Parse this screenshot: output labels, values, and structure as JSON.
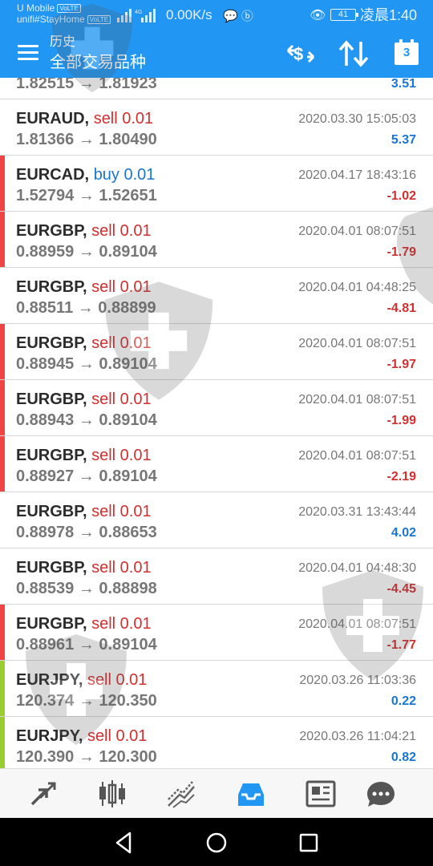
{
  "status_bar": {
    "carrier_line1": "U Mobile",
    "carrier_line2": "unifi#StayHome",
    "volte_tag": "VoLTE",
    "net_speed": "0.00K/s",
    "battery": "41",
    "time": "凌晨1:40"
  },
  "header": {
    "title": "历史",
    "subtitle": "全部交易品种",
    "calendar_badge": "3",
    "colors": {
      "primary": "#2196f3"
    }
  },
  "trades": [
    {
      "symbol": "",
      "action": "",
      "prices": "1.82515 → 1.81923",
      "time": "",
      "profit": "3.51",
      "sign": "pos",
      "bar": ""
    },
    {
      "symbol": "EURAUD,",
      "action": "sell 0.01",
      "prices": "1.81366 → 1.80490",
      "time": "2020.03.30 15:05:03",
      "profit": "5.37",
      "sign": "pos",
      "bar": ""
    },
    {
      "symbol": "EURCAD,",
      "action": "buy 0.01",
      "prices": "1.52794 → 1.52651",
      "time": "2020.04.17 18:43:16",
      "profit": "-1.02",
      "sign": "neg",
      "bar": "#ef4444"
    },
    {
      "symbol": "EURGBP,",
      "action": "sell 0.01",
      "prices": "0.88959 → 0.89104",
      "time": "2020.04.01 08:07:51",
      "profit": "-1.79",
      "sign": "neg",
      "bar": "#ef4444"
    },
    {
      "symbol": "EURGBP,",
      "action": "sell 0.01",
      "prices": "0.88511 → 0.88899",
      "time": "2020.04.01 04:48:25",
      "profit": "-4.81",
      "sign": "neg",
      "bar": ""
    },
    {
      "symbol": "EURGBP,",
      "action": "sell 0.01",
      "prices": "0.88945 → 0.89104",
      "time": "2020.04.01 08:07:51",
      "profit": "-1.97",
      "sign": "neg",
      "bar": "#ef4444"
    },
    {
      "symbol": "EURGBP,",
      "action": "sell 0.01",
      "prices": "0.88943 → 0.89104",
      "time": "2020.04.01 08:07:51",
      "profit": "-1.99",
      "sign": "neg",
      "bar": "#ef4444"
    },
    {
      "symbol": "EURGBP,",
      "action": "sell 0.01",
      "prices": "0.88927 → 0.89104",
      "time": "2020.04.01 08:07:51",
      "profit": "-2.19",
      "sign": "neg",
      "bar": "#ef4444"
    },
    {
      "symbol": "EURGBP,",
      "action": "sell 0.01",
      "prices": "0.88978 → 0.88653",
      "time": "2020.03.31 13:43:44",
      "profit": "4.02",
      "sign": "pos",
      "bar": ""
    },
    {
      "symbol": "EURGBP,",
      "action": "sell 0.01",
      "prices": "0.88539 → 0.88898",
      "time": "2020.04.01 04:48:30",
      "profit": "-4.45",
      "sign": "neg",
      "bar": ""
    },
    {
      "symbol": "EURGBP,",
      "action": "sell 0.01",
      "prices": "0.88961 → 0.89104",
      "time": "2020.04.01 08:07:51",
      "profit": "-1.77",
      "sign": "neg",
      "bar": "#ef4444"
    },
    {
      "symbol": "EURJPY,",
      "action": "sell 0.01",
      "prices": "120.374 → 120.350",
      "time": "2020.03.26 11:03:36",
      "profit": "0.22",
      "sign": "pos",
      "bar": "#9acd32"
    },
    {
      "symbol": "EURJPY,",
      "action": "sell 0.01",
      "prices": "120.390 → 120.300",
      "time": "2020.03.26 11:04:21",
      "profit": "0.82",
      "sign": "pos",
      "bar": "#9acd32"
    }
  ],
  "bottom_nav": [
    {
      "name": "quotes",
      "icon": "quotes-arrows-icon",
      "active": false
    },
    {
      "name": "chart",
      "icon": "candlestick-icon",
      "active": false
    },
    {
      "name": "trade",
      "icon": "trend-lines-icon",
      "active": false
    },
    {
      "name": "history",
      "icon": "inbox-icon",
      "active": true
    },
    {
      "name": "news",
      "icon": "news-icon",
      "active": false
    },
    {
      "name": "chat",
      "icon": "chat-bubble-icon",
      "active": false
    }
  ]
}
